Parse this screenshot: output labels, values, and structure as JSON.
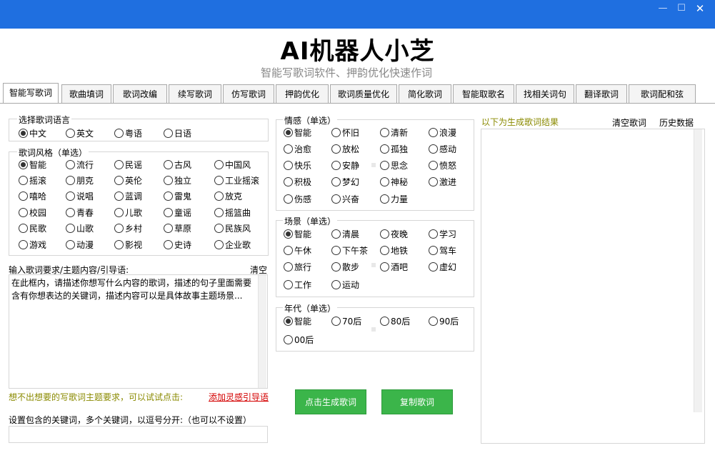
{
  "window": {
    "minimize": "—",
    "maximize": "☐",
    "close": "✕"
  },
  "app": {
    "title": "AI机器人小芝",
    "subtitle": "智能写歌词软件、押韵优化快速作词"
  },
  "tabs": [
    "智能写歌词",
    "歌曲填词",
    "歌词改编",
    "续写歌词",
    "仿写歌词",
    "押韵优化",
    "歌词质量优化",
    "简化歌词",
    "智能取歌名",
    "找相关词句",
    "翻译歌词",
    "歌词配和弦"
  ],
  "language": {
    "title": "选择歌词语言",
    "options": [
      "中文",
      "英文",
      "粤语",
      "日语"
    ],
    "selected": 0
  },
  "style": {
    "title": "歌词风格（单选）",
    "options": [
      "智能",
      "流行",
      "民谣",
      "古风",
      "中国风",
      "摇滚",
      "朋克",
      "英伦",
      "独立",
      "工业摇滚",
      "嘻哈",
      "说唱",
      "蓝调",
      "雷鬼",
      "放克",
      "校园",
      "青春",
      "儿歌",
      "童谣",
      "摇篮曲",
      "民歌",
      "山歌",
      "乡村",
      "草原",
      "民族风",
      "游戏",
      "动漫",
      "影视",
      "史诗",
      "企业歌"
    ],
    "selected": 0
  },
  "request": {
    "label": "输入歌词要求/主题内容/引导语:",
    "clear": "清空",
    "placeholder": "在此框内，请描述你想写什么内容的歌词，描述的句子里面需要含有你想表达的关键词，描述内容可以是具体故事主题场景..."
  },
  "hint": {
    "text": "想不出想要的写歌词主题要求，可以试试点击:",
    "link": "添加灵感引导语"
  },
  "keywords": {
    "label": "设置包含的关键词，多个关键词，以逗号分开:（也可以不设置）",
    "value": ""
  },
  "emotion": {
    "title": "情感（单选）",
    "options": [
      "智能",
      "怀旧",
      "清新",
      "浪漫",
      "治愈",
      "放松",
      "孤独",
      "感动",
      "快乐",
      "安静",
      "思念",
      "愤怒",
      "积极",
      "梦幻",
      "神秘",
      "激进",
      "伤感",
      "兴奋",
      "力量"
    ],
    "selected": 0
  },
  "scene": {
    "title": "场景（单选）",
    "options": [
      "智能",
      "清晨",
      "夜晚",
      "学习",
      "午休",
      "下午茶",
      "地铁",
      "驾车",
      "旅行",
      "散步",
      "酒吧",
      "虚幻",
      "工作",
      "运动"
    ],
    "selected": 0
  },
  "era": {
    "title": "年代（单选）",
    "options": [
      "智能",
      "70后",
      "80后",
      "90后",
      "00后"
    ],
    "selected": 0
  },
  "buttons": {
    "generate": "点击生成歌词",
    "copy": "复制歌词"
  },
  "result": {
    "label": "以下为生成歌词结果",
    "clear": "清空歌词",
    "history": "历史数据"
  }
}
